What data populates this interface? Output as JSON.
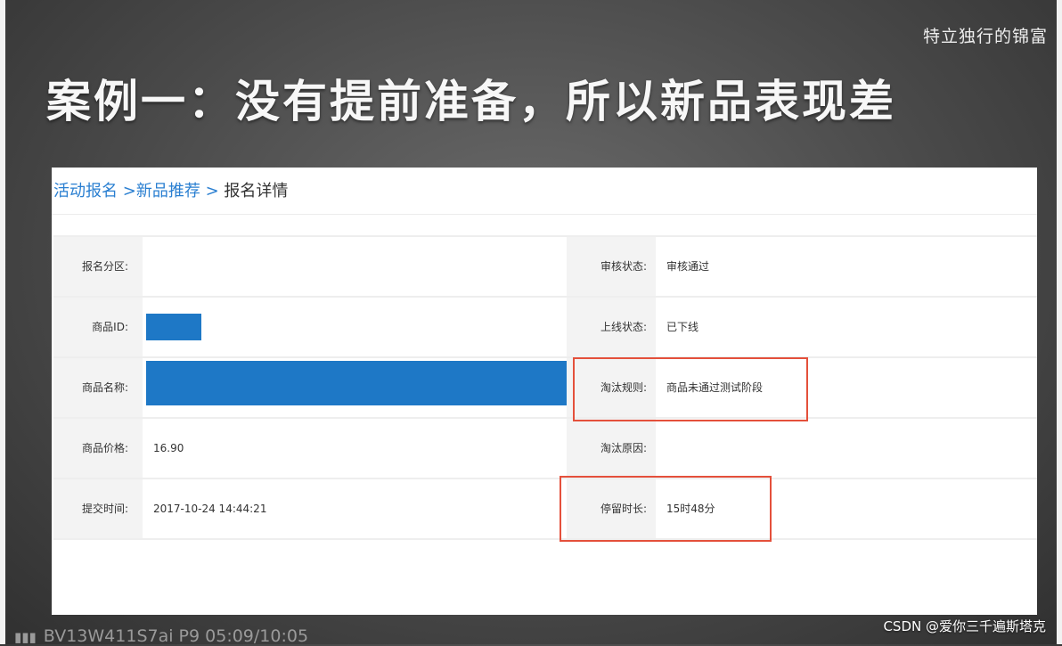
{
  "overlay": {
    "channel_name": "特立独行的锦富",
    "headline": "案例一：没有提前准备，所以新品表现差",
    "video_id": "BV13W411S7ai P9 05:09/10:05",
    "watermark": "CSDN @爱你三千遍斯塔克"
  },
  "breadcrumb": {
    "items": [
      "活动报名",
      "新品推荐",
      "报名详情"
    ],
    "separator": ">"
  },
  "details": {
    "rows": [
      {
        "left_label": "报名分区:",
        "left_value": "",
        "right_label": "审核状态:",
        "right_value": "审核通过"
      },
      {
        "left_label": "商品ID:",
        "left_value": "",
        "right_label": "上线状态:",
        "right_value": "已下线"
      },
      {
        "left_label": "商品名称:",
        "left_value": "",
        "right_label": "淘汰规则:",
        "right_value": "商品未通过测试阶段"
      },
      {
        "left_label": "商品价格:",
        "left_value": "16.90",
        "right_label": "淘汰原因:",
        "right_value": ""
      },
      {
        "left_label": "提交时间:",
        "left_value": "2017-10-24 14:44:21",
        "right_label": "停留时长:",
        "right_value": "15时48分"
      }
    ]
  },
  "colors": {
    "link": "#2a7fd1",
    "redaction": "#1e78c6",
    "highlight_box": "#e4503b"
  }
}
